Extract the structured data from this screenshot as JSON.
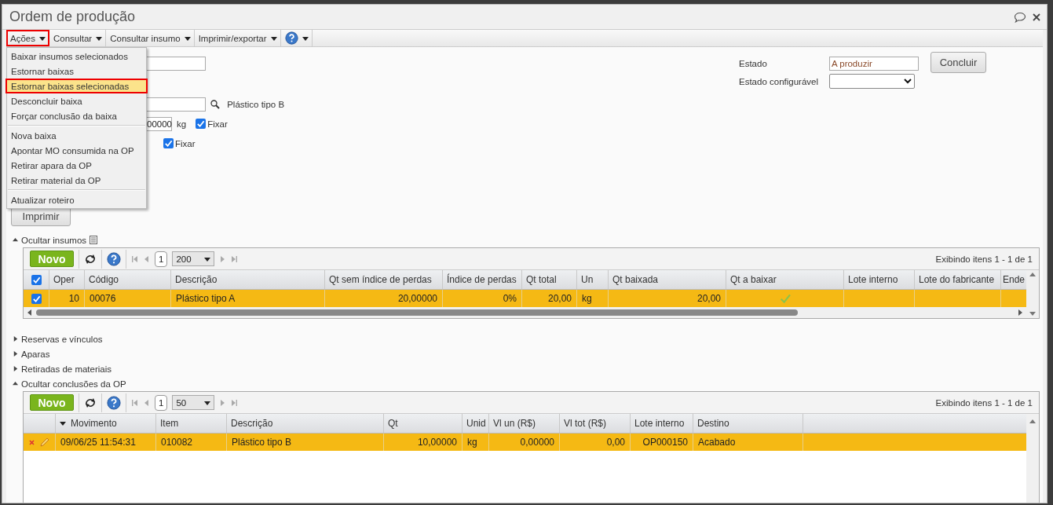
{
  "window": {
    "title": "Ordem de produção"
  },
  "toolbar": [
    {
      "label": "Ações",
      "kind": "menu",
      "selected": true
    },
    {
      "label": "Consultar",
      "kind": "menu",
      "selected": false
    },
    {
      "label": "Consultar insumo",
      "kind": "menu",
      "selected": false
    },
    {
      "label": "Imprimir/exportar",
      "kind": "menu",
      "selected": false
    },
    {
      "kind": "help",
      "selected": false
    }
  ],
  "actions_menu": {
    "groups": [
      [
        {
          "label": "Baixar insumos selecionados",
          "selected": false
        },
        {
          "label": "Estornar baixas",
          "selected": false
        },
        {
          "label": "Estornar baixas selecionadas",
          "selected": true
        },
        {
          "label": "Desconcluir baixa",
          "selected": false
        },
        {
          "label": "Forçar conclusão da baixa",
          "selected": false
        }
      ],
      [
        {
          "label": "Nova baixa",
          "selected": false
        },
        {
          "label": "Apontar MO consumida na OP",
          "selected": false
        },
        {
          "label": "Retirar apara da OP",
          "selected": false
        },
        {
          "label": "Retirar material da OP",
          "selected": false
        }
      ],
      [
        {
          "label": "Atualizar roteiro",
          "selected": false
        }
      ]
    ]
  },
  "form": {
    "product_name": "Plástico tipo B",
    "quantity": {
      "value": "00000",
      "unit": "kg"
    },
    "fix_checks": [
      {
        "label": "Fixar",
        "checked": true
      },
      {
        "label": "Fixar",
        "checked": true
      }
    ],
    "print_button": "Imprimir",
    "state": {
      "label": "Estado",
      "value": "A produzir"
    },
    "configurable_state": {
      "label": "Estado configurável"
    },
    "conclude_button": "Concluir"
  },
  "inputs_section": {
    "label": "Ocultar insumos",
    "expanded": true
  },
  "inputs_grid": {
    "new_button": "Novo",
    "page": "1",
    "page_size": "200",
    "summary": "Exibindo itens 1 - 1 de 1",
    "all_checked": true,
    "columns": [
      {
        "label": "Oper"
      },
      {
        "label": "Código"
      },
      {
        "label": "Descrição"
      },
      {
        "label": "Qt sem índice de perdas"
      },
      {
        "label": "Índice de perdas"
      },
      {
        "label": "Qt total"
      },
      {
        "label": "Un"
      },
      {
        "label": "Qt baixada"
      },
      {
        "label": "Qt a baixar"
      },
      {
        "label": "Lote interno"
      },
      {
        "label": "Lote do fabricante"
      },
      {
        "label": "Ende"
      }
    ],
    "rows": [
      {
        "selected": true,
        "checked": true,
        "cells": [
          "10",
          "00076",
          "Plástico tipo A",
          "20,00000",
          "0%",
          "20,00",
          "kg",
          "20,00",
          true
        ]
      }
    ]
  },
  "collapsed_sections": [
    {
      "label": "Reservas e vínculos",
      "expanded": false
    },
    {
      "label": "Aparas",
      "expanded": false
    },
    {
      "label": "Retiradas de materiais",
      "expanded": false
    },
    {
      "label": "Ocultar conclusões da OP",
      "expanded": true
    }
  ],
  "conclusions_grid": {
    "new_button": "Novo",
    "page": "1",
    "page_size": "50",
    "summary": "Exibindo itens 1 - 1 de 1",
    "columns": [
      {
        "label": "Movimento",
        "sorted": true
      },
      {
        "label": "Item",
        "sorted": false
      },
      {
        "label": "Descrição",
        "sorted": false
      },
      {
        "label": "Qt",
        "sorted": false
      },
      {
        "label": "Unid",
        "sorted": false
      },
      {
        "label": "Vl un (R$)",
        "sorted": false
      },
      {
        "label": "Vl tot (R$)",
        "sorted": false
      },
      {
        "label": "Lote interno",
        "sorted": false
      },
      {
        "label": "Destino",
        "sorted": false
      }
    ],
    "rows": [
      {
        "selected": true,
        "cells": [
          "09/06/25 11:54:31",
          "010082",
          "Plástico tipo B",
          "10,00000",
          "kg",
          "0,00000",
          "0,00",
          "OP000150",
          "Acabado"
        ]
      }
    ]
  }
}
